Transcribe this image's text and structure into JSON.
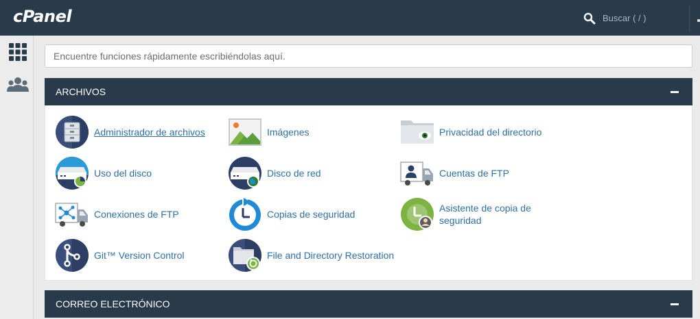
{
  "topbar": {
    "logo": "cPanel",
    "search_label": "Buscar ( / )"
  },
  "quick_search": {
    "placeholder": "Encuentre funciones rápidamente escribiéndolas aquí."
  },
  "sections": [
    {
      "title": "ARCHIVOS",
      "items": [
        {
          "label": "Administrador de archivos",
          "icon": "file-manager-icon"
        },
        {
          "label": "Imágenes",
          "icon": "images-icon"
        },
        {
          "label": "Privacidad del directorio",
          "icon": "directory-privacy-icon"
        },
        {
          "label": "Uso del disco",
          "icon": "disk-usage-icon"
        },
        {
          "label": "Disco de red",
          "icon": "network-disk-icon"
        },
        {
          "label": "Cuentas de FTP",
          "icon": "ftp-accounts-icon"
        },
        {
          "label": "Conexiones de FTP",
          "icon": "ftp-connections-icon"
        },
        {
          "label": "Copias de seguridad",
          "icon": "backup-icon"
        },
        {
          "label": "Asistente de copia de",
          "label_line2": "seguridad",
          "icon": "backup-wizard-icon"
        },
        {
          "label": "Git™ Version Control",
          "icon": "git-icon"
        },
        {
          "label": "File and Directory Restoration",
          "icon": "file-restoration-icon"
        }
      ]
    },
    {
      "title": "CORREO ELECTRÓNICO"
    }
  ],
  "colors": {
    "header_bg": "#293a4a",
    "link": "#2e6fa8",
    "page_bg": "#ebebeb",
    "icon_navy": "#2c3e64",
    "icon_blue": "#1f8ad6",
    "icon_green": "#7cb342"
  }
}
